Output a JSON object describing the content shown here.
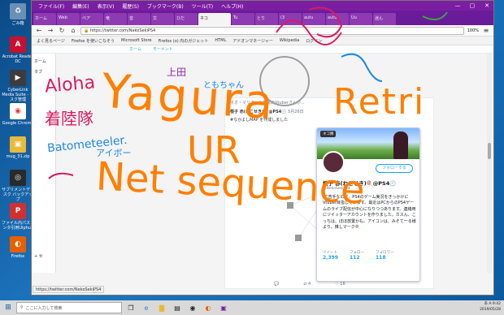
{
  "desktop": {
    "icons": [
      {
        "label": "ごみ箱",
        "icon": "recycle-bin-icon",
        "color": "#6b8fb5",
        "glyph": "♻"
      },
      {
        "label": "Acrobat Reader DC",
        "icon": "acrobat-icon",
        "color": "#c8102e",
        "glyph": "A"
      },
      {
        "label": "CyberLink Media Suite - タスク管理",
        "icon": "cyberlink-icon",
        "color": "#3c3c3c",
        "glyph": "▶"
      },
      {
        "label": "Google Chrome",
        "icon": "chrome-icon",
        "color": "#ffffff",
        "glyph": "◉"
      },
      {
        "label": "mug_31.zip",
        "icon": "zip-icon",
        "color": "#e8b93a",
        "glyph": "▣"
      },
      {
        "label": "サブリメントディスク バックアップ",
        "icon": "disk-icon",
        "color": "#2a2a2a",
        "glyph": "◎"
      },
      {
        "label": "ファイル内パスコンタ引用Ulphu?",
        "icon": "pdf-icon",
        "color": "#d32f2f",
        "glyph": "P"
      },
      {
        "label": "Firefox",
        "icon": "firefox-icon",
        "color": "#e66000",
        "glyph": "◐"
      }
    ]
  },
  "browser": {
    "menu": [
      "ファイル(F)",
      "編集(E)",
      "表示(V)",
      "履歴(S)",
      "ブックマーク(B)",
      "ツール(T)",
      "ヘルプ(H)"
    ],
    "tabs": [
      {
        "label": "ホーム"
      },
      {
        "label": "Web"
      },
      {
        "label": "ベア"
      },
      {
        "label": "竜"
      },
      {
        "label": "音"
      },
      {
        "label": "文"
      },
      {
        "label": "ひだ"
      },
      {
        "label": "ネコ",
        "active": true
      },
      {
        "label": "Tu"
      },
      {
        "label": "とり"
      },
      {
        "label": "(3"
      },
      {
        "label": "autu"
      },
      {
        "label": "autu"
      },
      {
        "label": "Uu"
      },
      {
        "label": "迷ん"
      }
    ],
    "url": "https://twitter.com/NekoSekiPS4",
    "zoom": "100%",
    "bookmarks": [
      "よく見るページ",
      "Firefox を使いこなそう",
      "Microsoft Store",
      "Firefox (o) 内のガジェット",
      "HTML",
      "アドオンマネージャー",
      "Wikipedia",
      "ログイン"
    ],
    "twitter_nav": [
      "ホーム",
      "モーメント"
    ],
    "left_panel": [
      "ホーム",
      "タブ",
      "+ セ"
    ],
    "status_url": "https://twitter.com/NekoSekiPS4"
  },
  "feed": {
    "retweet_line": "ネオ・マリオン@地獄のVtuberさんが...",
    "tweet_author": "根子 赤(ねこせき)🍭@PS4🕘",
    "tweet_date": "5月26日",
    "tweet_text": "#なかよしMAP を作成しました",
    "tweet_tail": "なか",
    "retweet_count": "4",
    "like_count": "16"
  },
  "profile_card": {
    "banner_tag": "ネコ隊",
    "follow_label": "フォローする",
    "name": "根子 赤(ねこせき)🍭@PS4🕘",
    "handle": "@NekoSekiPS4",
    "bio": "PC苦手なので、PS4のゲーム実況をきっかけにVtuber目指しています。最近はPCからのPS4ゲームのライブ配信が中心になりつつあります。連絡用にツイッターアカウントを作りました。カスん、こっちは、ぼほ放置かも。アイコンは、みそて一る様より。推しマーク🍭",
    "stats": [
      {
        "label": "ツイート",
        "value": "2,399"
      },
      {
        "label": "フォロー",
        "value": "112"
      },
      {
        "label": "フォロワー",
        "value": "118"
      }
    ]
  },
  "taskbar": {
    "search_placeholder": "ここに入力して検索",
    "time": "9:42",
    "date": "2019/05/28",
    "tray_labels": [
      "あ",
      "A"
    ]
  },
  "scribbles": {
    "yagura": "Yagura",
    "retri": "Retri",
    "ur": "UR",
    "net_sequence": "Net sequence",
    "aloha": "Aloha",
    "zhuoneng": "着陸隊",
    "batometeeler": "Batometeeler.",
    "aibo": "アイボー",
    "ueda": "上田",
    "tomo": "ともちゃん",
    "colors": {
      "orange": "#ff7f00",
      "red": "#d81b60",
      "blue": "#1e88e5",
      "green": "#43a047",
      "purple": "#8e24aa"
    }
  }
}
